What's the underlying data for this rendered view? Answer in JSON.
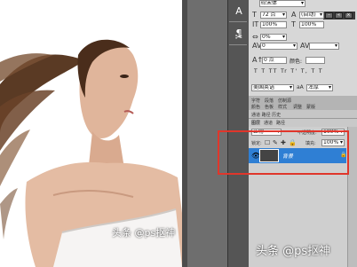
{
  "character_panel": {
    "font_family": "砼宋体",
    "font_size": "72 点",
    "leading": "(自动)",
    "vertical_scale": "100%",
    "horizontal_scale": "100%",
    "tracking_pct": "0%",
    "kerning": "0",
    "baseline_shift": "0 点",
    "color_label": "颜色:",
    "type_style_buttons": "T T TT Tr T' T, T T",
    "language": "美国英语",
    "anti_alias_icon": "aA",
    "anti_alias": "浑厚"
  },
  "panel_tabs": {
    "row1": [
      "字符",
      "段落",
      "仿制源"
    ],
    "row2": [
      "颜色",
      "色板",
      "样式"
    ],
    "row3": [
      "调整",
      "蒙版"
    ],
    "row4": "通道 路径 历史",
    "layers_tab": "图层",
    "channels_tab": "通道",
    "paths_tab": "路径"
  },
  "layers": {
    "blend_mode": "正常",
    "opacity_label": "不透明度:",
    "opacity": "100%",
    "lock_label": "锁定:",
    "fill_label": "填充:",
    "fill": "100%",
    "background_layer_name": "背景"
  },
  "watermarks": {
    "photo": "头条 @ps抠神",
    "footer": "头条 @ps抠神"
  },
  "colors": {
    "highlight": "#e0362b",
    "selected_layer": "#2f7fd4"
  }
}
